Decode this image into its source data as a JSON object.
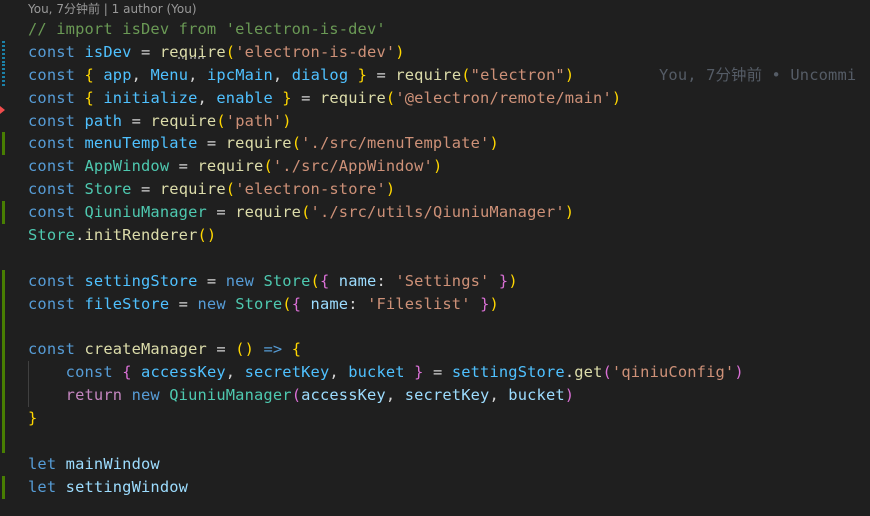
{
  "codelens": {
    "author_time": "You, 7分钟前",
    "separator": "|",
    "authors": "1 author (You)"
  },
  "blame": "You, 7分钟前 • Uncommi",
  "colors": {
    "background": "#1f1f1f",
    "keyword": "#569cd6",
    "control": "#c586c0",
    "variable": "#9cdcfe",
    "constant": "#4fc1ff",
    "function": "#dcdcaa",
    "class": "#4ec9b0",
    "string": "#ce9178",
    "comment": "#6a9955",
    "punctuation": "#d4d4d4",
    "bracket1": "#ffd700",
    "bracket2": "#da70d6",
    "bracket3": "#179fff",
    "gutter_added": "#487e02",
    "gutter_modified": "#1b81a8",
    "gutter_deleted": "#f14c4c"
  },
  "lines": [
    {
      "gutter": "none",
      "tokens": [
        [
          "cmt",
          "// import isDev from 'electron-is-dev'"
        ]
      ]
    },
    {
      "gutter": "modified",
      "tokens": [
        [
          "kw",
          "const"
        ],
        [
          "p",
          " "
        ],
        [
          "const",
          "isDev"
        ],
        [
          "p",
          " = "
        ],
        [
          "fn",
          "re"
        ],
        [
          "fnsq",
          "qui"
        ],
        [
          "fn",
          "re"
        ],
        [
          "b1",
          "("
        ],
        [
          "str",
          "'electron-is-dev'"
        ],
        [
          "b1",
          ")"
        ]
      ]
    },
    {
      "gutter": "modified",
      "blame": true,
      "tokens": [
        [
          "kw",
          "const"
        ],
        [
          "p",
          " "
        ],
        [
          "b1",
          "{"
        ],
        [
          "p",
          " "
        ],
        [
          "const",
          "app"
        ],
        [
          "p",
          ", "
        ],
        [
          "const",
          "Menu"
        ],
        [
          "p",
          ", "
        ],
        [
          "const",
          "ipcMain"
        ],
        [
          "p",
          ", "
        ],
        [
          "const",
          "dialog"
        ],
        [
          "p",
          " "
        ],
        [
          "b1",
          "}"
        ],
        [
          "p",
          " = "
        ],
        [
          "fn",
          "require"
        ],
        [
          "b1",
          "("
        ],
        [
          "str",
          "\"electron\""
        ],
        [
          "b1",
          ")"
        ]
      ]
    },
    {
      "gutter": "none",
      "tokens": [
        [
          "kw",
          "const"
        ],
        [
          "p",
          " "
        ],
        [
          "b1",
          "{"
        ],
        [
          "p",
          " "
        ],
        [
          "const",
          "initialize"
        ],
        [
          "p",
          ", "
        ],
        [
          "const",
          "enable"
        ],
        [
          "p",
          " "
        ],
        [
          "b1",
          "}"
        ],
        [
          "p",
          " = "
        ],
        [
          "fn",
          "require"
        ],
        [
          "b1",
          "("
        ],
        [
          "str",
          "'@electron/remote/main'"
        ],
        [
          "b1",
          ")"
        ]
      ]
    },
    {
      "gutter": "deleted",
      "tokens": [
        [
          "kw",
          "const"
        ],
        [
          "p",
          " "
        ],
        [
          "const",
          "path"
        ],
        [
          "p",
          " = "
        ],
        [
          "fn",
          "require"
        ],
        [
          "b1",
          "("
        ],
        [
          "str",
          "'path'"
        ],
        [
          "b1",
          ")"
        ]
      ]
    },
    {
      "gutter": "added",
      "tokens": [
        [
          "kw",
          "const"
        ],
        [
          "p",
          " "
        ],
        [
          "const",
          "menuTemplate"
        ],
        [
          "p",
          " = "
        ],
        [
          "fn",
          "require"
        ],
        [
          "b1",
          "("
        ],
        [
          "str",
          "'./src/menuTemplate'"
        ],
        [
          "b1",
          ")"
        ]
      ]
    },
    {
      "gutter": "none",
      "tokens": [
        [
          "kw",
          "const"
        ],
        [
          "p",
          " "
        ],
        [
          "cls",
          "AppWindow"
        ],
        [
          "p",
          " = "
        ],
        [
          "fn",
          "require"
        ],
        [
          "b1",
          "("
        ],
        [
          "str",
          "'./src/AppWindow'"
        ],
        [
          "b1",
          ")"
        ]
      ]
    },
    {
      "gutter": "none",
      "tokens": [
        [
          "kw",
          "const"
        ],
        [
          "p",
          " "
        ],
        [
          "cls",
          "Store"
        ],
        [
          "p",
          " = "
        ],
        [
          "fn",
          "require"
        ],
        [
          "b1",
          "("
        ],
        [
          "str",
          "'electron-store'"
        ],
        [
          "b1",
          ")"
        ]
      ]
    },
    {
      "gutter": "added",
      "tokens": [
        [
          "kw",
          "const"
        ],
        [
          "p",
          " "
        ],
        [
          "cls",
          "QiuniuManager"
        ],
        [
          "p",
          " = "
        ],
        [
          "fn",
          "require"
        ],
        [
          "b1",
          "("
        ],
        [
          "str",
          "'./src/utils/QiuniuManager'"
        ],
        [
          "b1",
          ")"
        ]
      ]
    },
    {
      "gutter": "none",
      "tokens": [
        [
          "cls",
          "Store"
        ],
        [
          "p",
          "."
        ],
        [
          "fn",
          "initRenderer"
        ],
        [
          "b1",
          "()"
        ]
      ]
    },
    {
      "gutter": "none",
      "tokens": []
    },
    {
      "gutter": "added",
      "tokens": [
        [
          "kw",
          "const"
        ],
        [
          "p",
          " "
        ],
        [
          "const",
          "settingStore"
        ],
        [
          "p",
          " = "
        ],
        [
          "kw",
          "new"
        ],
        [
          "p",
          " "
        ],
        [
          "cls",
          "Store"
        ],
        [
          "b1",
          "("
        ],
        [
          "b2",
          "{"
        ],
        [
          "p",
          " "
        ],
        [
          "var",
          "name"
        ],
        [
          "p",
          ": "
        ],
        [
          "str",
          "'Settings'"
        ],
        [
          "p",
          " "
        ],
        [
          "b2",
          "}"
        ],
        [
          "b1",
          ")"
        ]
      ]
    },
    {
      "gutter": "added",
      "tokens": [
        [
          "kw",
          "const"
        ],
        [
          "p",
          " "
        ],
        [
          "const",
          "fileStore"
        ],
        [
          "p",
          " = "
        ],
        [
          "kw",
          "new"
        ],
        [
          "p",
          " "
        ],
        [
          "cls",
          "Store"
        ],
        [
          "b1",
          "("
        ],
        [
          "b2",
          "{"
        ],
        [
          "p",
          " "
        ],
        [
          "var",
          "name"
        ],
        [
          "p",
          ": "
        ],
        [
          "str",
          "'Fileslist'"
        ],
        [
          "p",
          " "
        ],
        [
          "b2",
          "}"
        ],
        [
          "b1",
          ")"
        ]
      ]
    },
    {
      "gutter": "added",
      "tokens": []
    },
    {
      "gutter": "added",
      "tokens": [
        [
          "kw",
          "const"
        ],
        [
          "p",
          " "
        ],
        [
          "fn",
          "createManager"
        ],
        [
          "p",
          " = "
        ],
        [
          "b1",
          "()"
        ],
        [
          "p",
          " "
        ],
        [
          "kw",
          "=>"
        ],
        [
          "p",
          " "
        ],
        [
          "b1",
          "{"
        ]
      ]
    },
    {
      "gutter": "added",
      "indent": true,
      "tokens": [
        [
          "p",
          "    "
        ],
        [
          "kw",
          "const"
        ],
        [
          "p",
          " "
        ],
        [
          "b2",
          "{"
        ],
        [
          "p",
          " "
        ],
        [
          "const",
          "accessKey"
        ],
        [
          "p",
          ", "
        ],
        [
          "const",
          "secretKey"
        ],
        [
          "p",
          ", "
        ],
        [
          "const",
          "bucket"
        ],
        [
          "p",
          " "
        ],
        [
          "b2",
          "}"
        ],
        [
          "p",
          " = "
        ],
        [
          "const",
          "settingStore"
        ],
        [
          "p",
          "."
        ],
        [
          "fn",
          "get"
        ],
        [
          "b2",
          "("
        ],
        [
          "str",
          "'qiniuConfig'"
        ],
        [
          "b2",
          ")"
        ]
      ]
    },
    {
      "gutter": "added",
      "indent": true,
      "tokens": [
        [
          "p",
          "    "
        ],
        [
          "ctl",
          "return"
        ],
        [
          "p",
          " "
        ],
        [
          "kw",
          "new"
        ],
        [
          "p",
          " "
        ],
        [
          "cls",
          "QiuniuManager"
        ],
        [
          "b2",
          "("
        ],
        [
          "var",
          "accessKey"
        ],
        [
          "p",
          ", "
        ],
        [
          "var",
          "secretKey"
        ],
        [
          "p",
          ", "
        ],
        [
          "var",
          "bucket"
        ],
        [
          "b2",
          ")"
        ]
      ]
    },
    {
      "gutter": "added",
      "tokens": [
        [
          "b1",
          "}"
        ]
      ]
    },
    {
      "gutter": "added",
      "tokens": []
    },
    {
      "gutter": "none",
      "tokens": [
        [
          "kw",
          "let"
        ],
        [
          "p",
          " "
        ],
        [
          "var",
          "mainWindow"
        ]
      ]
    },
    {
      "gutter": "added",
      "tokens": [
        [
          "kw",
          "let"
        ],
        [
          "p",
          " "
        ],
        [
          "var",
          "settingWindow"
        ]
      ]
    }
  ]
}
